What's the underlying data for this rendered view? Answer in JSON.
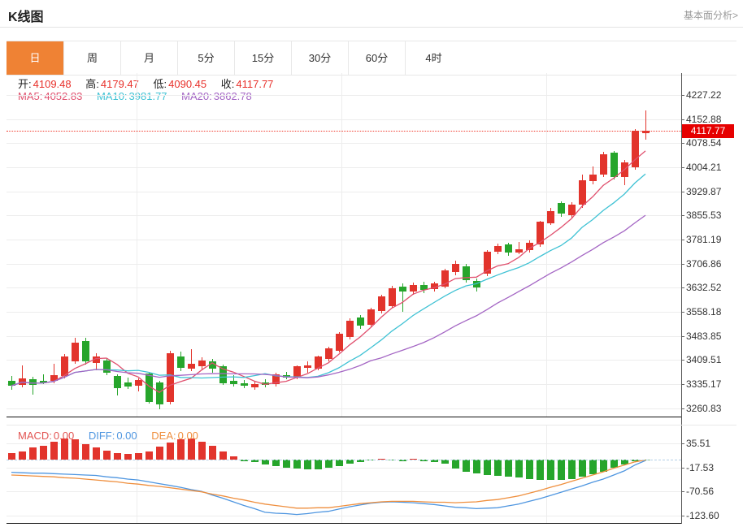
{
  "header": {
    "title": "K线图",
    "link": "基本面分析>"
  },
  "tabs": {
    "items": [
      {
        "id": "day",
        "label": "日",
        "active": true
      },
      {
        "id": "week",
        "label": "周",
        "active": false
      },
      {
        "id": "month",
        "label": "月",
        "active": false
      },
      {
        "id": "5min",
        "label": "5分",
        "active": false
      },
      {
        "id": "15min",
        "label": "15分",
        "active": false
      },
      {
        "id": "30min",
        "label": "30分",
        "active": false
      },
      {
        "id": "60min",
        "label": "60分",
        "active": false
      },
      {
        "id": "4hour",
        "label": "4时",
        "active": false
      }
    ]
  },
  "info": {
    "open_label": "开:",
    "open": "4109.48",
    "high_label": "高:",
    "high": "4179.47",
    "low_label": "低:",
    "low": "4090.45",
    "close_label": "收:",
    "close": "4117.77"
  },
  "ma": {
    "ma5_label": "MA5:",
    "ma5": "4052.83",
    "ma10_label": "MA10:",
    "ma10": "3981.77",
    "ma20_label": "MA20:",
    "ma20": "3862.78"
  },
  "macd_header": {
    "macd_label": "MACD:",
    "macd": "0.00",
    "diff_label": "DIFF:",
    "diff": "0.00",
    "dea_label": "DEA:",
    "dea": "0.00"
  },
  "price_marker": {
    "value": "4117.77"
  },
  "colors": {
    "up": "#e2342c",
    "down": "#26a52b",
    "ma5": "#e0506e",
    "ma10": "#3fc2d4",
    "ma20": "#a466c4",
    "diff": "#4f96e0",
    "dea": "#ef8f3e",
    "marker_bg": "#e60000",
    "price_line": "#f03a2e",
    "tab_active_bg": "#ef8234",
    "value_red": "#e8302a",
    "macd_label": "#e25452"
  },
  "chart_data": {
    "type": "candlestick+macd",
    "title": "K线图 日线 (daily K-line)",
    "main_panel": {
      "y_tick_labels": [
        "4227.22",
        "4152.88",
        "4078.54",
        "4004.21",
        "3929.87",
        "3855.53",
        "3781.19",
        "3706.86",
        "3632.52",
        "3558.18",
        "3483.85",
        "3409.51",
        "3335.17",
        "3260.83"
      ],
      "last_price": 4117.77,
      "ma_periods": [
        5,
        10,
        20
      ],
      "candles_ohlc": [
        [
          3345,
          3360,
          3318,
          3330
        ],
        [
          3332,
          3392,
          3326,
          3352
        ],
        [
          3350,
          3358,
          3303,
          3333
        ],
        [
          3346,
          3365,
          3336,
          3340
        ],
        [
          3344,
          3398,
          3338,
          3362
        ],
        [
          3360,
          3428,
          3352,
          3420
        ],
        [
          3406,
          3477,
          3398,
          3462
        ],
        [
          3468,
          3478,
          3396,
          3405
        ],
        [
          3400,
          3430,
          3378,
          3420
        ],
        [
          3408,
          3415,
          3362,
          3370
        ],
        [
          3360,
          3366,
          3300,
          3322
        ],
        [
          3340,
          3356,
          3320,
          3328
        ],
        [
          3330,
          3354,
          3312,
          3347
        ],
        [
          3368,
          3372,
          3275,
          3280
        ],
        [
          3340,
          3345,
          3258,
          3272
        ],
        [
          3280,
          3438,
          3272,
          3430
        ],
        [
          3420,
          3435,
          3376,
          3385
        ],
        [
          3382,
          3442,
          3375,
          3398
        ],
        [
          3390,
          3418,
          3380,
          3408
        ],
        [
          3405,
          3412,
          3370,
          3382
        ],
        [
          3390,
          3395,
          3332,
          3338
        ],
        [
          3345,
          3362,
          3328,
          3335
        ],
        [
          3338,
          3348,
          3322,
          3330
        ],
        [
          3326,
          3344,
          3318,
          3336
        ],
        [
          3340,
          3350,
          3325,
          3332
        ],
        [
          3334,
          3370,
          3328,
          3365
        ],
        [
          3362,
          3372,
          3350,
          3356
        ],
        [
          3356,
          3394,
          3350,
          3390
        ],
        [
          3386,
          3405,
          3370,
          3392
        ],
        [
          3382,
          3424,
          3378,
          3420
        ],
        [
          3412,
          3450,
          3406,
          3446
        ],
        [
          3438,
          3495,
          3432,
          3490
        ],
        [
          3480,
          3538,
          3474,
          3532
        ],
        [
          3540,
          3548,
          3505,
          3515
        ],
        [
          3518,
          3572,
          3512,
          3565
        ],
        [
          3560,
          3612,
          3552,
          3606
        ],
        [
          3576,
          3638,
          3570,
          3631
        ],
        [
          3636,
          3645,
          3558,
          3620
        ],
        [
          3622,
          3648,
          3610,
          3641
        ],
        [
          3642,
          3650,
          3615,
          3626
        ],
        [
          3628,
          3652,
          3620,
          3645
        ],
        [
          3636,
          3692,
          3630,
          3686
        ],
        [
          3680,
          3715,
          3672,
          3706
        ],
        [
          3698,
          3705,
          3648,
          3656
        ],
        [
          3653,
          3660,
          3622,
          3633
        ],
        [
          3676,
          3748,
          3668,
          3743
        ],
        [
          3743,
          3768,
          3736,
          3761
        ],
        [
          3766,
          3772,
          3732,
          3740
        ],
        [
          3742,
          3775,
          3736,
          3752
        ],
        [
          3748,
          3778,
          3740,
          3772
        ],
        [
          3766,
          3840,
          3758,
          3836
        ],
        [
          3832,
          3880,
          3826,
          3870
        ],
        [
          3894,
          3900,
          3852,
          3861
        ],
        [
          3856,
          3896,
          3848,
          3889
        ],
        [
          3889,
          3983,
          3880,
          3964
        ],
        [
          3961,
          4006,
          3952,
          3981
        ],
        [
          3982,
          4052,
          3975,
          4045
        ],
        [
          4050,
          4055,
          3966,
          3974
        ],
        [
          3974,
          4026,
          3950,
          4020
        ],
        [
          4003,
          4122,
          3998,
          4116
        ],
        [
          4109.48,
          4179.47,
          4090.45,
          4117.77
        ]
      ]
    },
    "macd_panel": {
      "y_tick_labels": [
        "35.51",
        "-17.53",
        "-70.56",
        "-123.60"
      ],
      "histogram": [
        14,
        18,
        26,
        30,
        40,
        46,
        44,
        34,
        26,
        20,
        15,
        13,
        14,
        18,
        28,
        38,
        44,
        46,
        40,
        30,
        18,
        8,
        -3,
        -6,
        -10,
        -14,
        -17,
        -20,
        -22,
        -21,
        -18,
        -14,
        -9,
        -5,
        -2,
        2,
        -2,
        -4,
        2,
        -3,
        -5,
        -8,
        -20,
        -26,
        -30,
        -34,
        -36,
        -38,
        -40,
        -42,
        -44,
        -45,
        -44,
        -42,
        -38,
        -32,
        -26,
        -18,
        -10,
        -4,
        -1
      ],
      "diff_line": [
        -28,
        -29,
        -30,
        -30,
        -31,
        -32,
        -33,
        -34,
        -35,
        -38,
        -40,
        -43,
        -45,
        -49,
        -53,
        -57,
        -61,
        -66,
        -70,
        -78,
        -85,
        -93,
        -101,
        -108,
        -116,
        -118,
        -119,
        -121,
        -119,
        -116,
        -114,
        -109,
        -104,
        -100,
        -96,
        -94,
        -93,
        -94,
        -95,
        -97,
        -99,
        -102,
        -105,
        -106,
        -108,
        -107,
        -106,
        -102,
        -98,
        -92,
        -86,
        -79,
        -72,
        -65,
        -58,
        -50,
        -43,
        -34,
        -25,
        -12,
        -2
      ],
      "dea_line": [
        -34,
        -35,
        -36,
        -37,
        -38,
        -40,
        -41,
        -43,
        -45,
        -47,
        -49,
        -52,
        -54,
        -57,
        -59,
        -62,
        -65,
        -68,
        -71,
        -76,
        -80,
        -85,
        -89,
        -94,
        -98,
        -101,
        -104,
        -107,
        -107,
        -106,
        -106,
        -103,
        -100,
        -97,
        -95,
        -93,
        -92,
        -92,
        -92,
        -93,
        -94,
        -94,
        -95,
        -94,
        -93,
        -90,
        -88,
        -84,
        -80,
        -74,
        -68,
        -61,
        -55,
        -48,
        -41,
        -34,
        -27,
        -19,
        -12,
        -5,
        -1
      ]
    }
  }
}
